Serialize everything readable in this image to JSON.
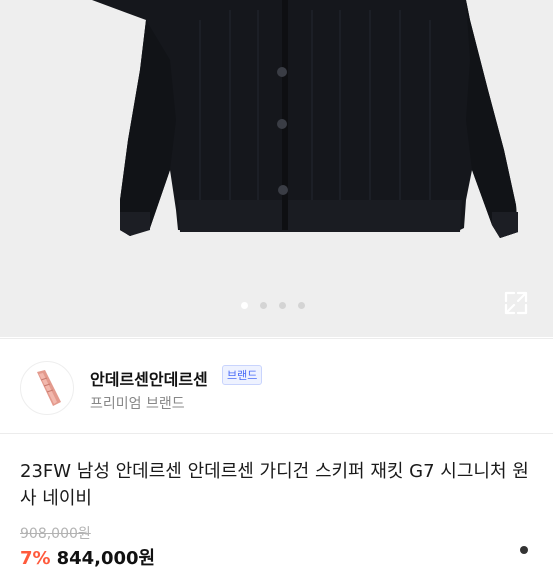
{
  "gallery": {
    "slide_count": 4,
    "active_slide": 1
  },
  "brand": {
    "name": "안데르센안데르센",
    "badge": "브랜드",
    "subtitle": "프리미엄 브랜드"
  },
  "product": {
    "title": "23FW 남성 안데르센 안데르센 가디건 스키퍼 재킷 G7 시그니처 원사 네이비",
    "original_price": "908,000원",
    "discount": "7%",
    "sale_price": "844,000원"
  },
  "colors": {
    "hero_bg": "#eeeeee",
    "cardigan": "#15171c",
    "discount": "#ff5a3c"
  },
  "icons": {
    "expand": "expand-icon"
  }
}
